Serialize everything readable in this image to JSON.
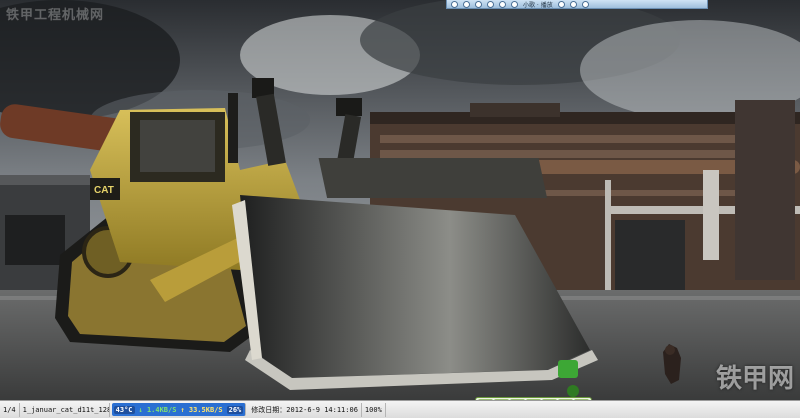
{
  "viewer": {
    "page_indicator": "1/4",
    "filename": "1_januar_cat_d11t_1280x",
    "modified_label": "修改日期：2012-6-9 14:11:06",
    "zoom": "100%"
  },
  "net_monitor": {
    "temperature": "43°C",
    "download": "↓ 1.4KB/S",
    "upload": "↑ 33.5KB/S",
    "usage": "26%"
  },
  "watermarks": {
    "top_left": "铁甲工程机械网",
    "bottom_right": "铁甲网"
  },
  "player_bar": {
    "text": "小歌 · 播放"
  },
  "ime_bar": {
    "mode": "中",
    "items": [
      "中",
      "°",
      "♪",
      "简",
      "▦",
      "✎",
      "⚙"
    ]
  }
}
